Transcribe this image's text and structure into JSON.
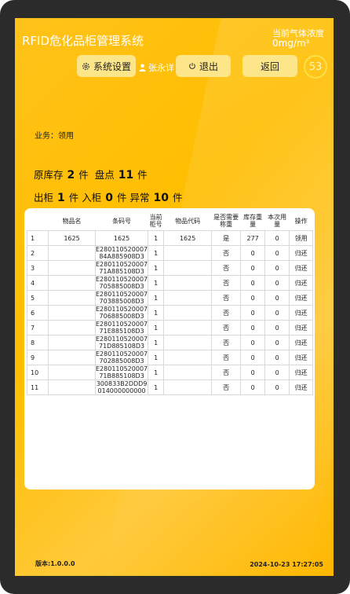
{
  "app": {
    "title": "RFID危化品柜管理系统"
  },
  "gas": {
    "label": "当前气体浓度",
    "value": "0mg/m³"
  },
  "toolbar": {
    "settings_label": "系统设置",
    "user_name": "张永详",
    "logout_label": "退出",
    "back_label": "返回",
    "countdown": "53"
  },
  "business": {
    "text": "业务：领用"
  },
  "stats": {
    "original_label": "原库存",
    "original_value": "2",
    "unit": "件",
    "check_label": "盘点",
    "check_value": "11",
    "out_label": "出柜",
    "out_value": "1",
    "in_label": "入柜",
    "in_value": "0",
    "abnormal_label": "异常",
    "abnormal_value": "10"
  },
  "table": {
    "headers": [
      "",
      "物品名",
      "条码号",
      "当前柜号",
      "物品代码",
      "是否需要称重",
      "库存重量",
      "本次用量",
      "操作"
    ],
    "rows": [
      [
        "1",
        "1625",
        "1625",
        "1",
        "1625",
        "是",
        "277",
        "0",
        "领用"
      ],
      [
        "2",
        "",
        "E280110520007 84A885908D3",
        "1",
        "",
        "否",
        "0",
        "0",
        "归还"
      ],
      [
        "3",
        "",
        "E280110520007 71A885108D3",
        "1",
        "",
        "否",
        "0",
        "0",
        "归还"
      ],
      [
        "4",
        "",
        "E280110520007 705885008D3",
        "1",
        "",
        "否",
        "0",
        "0",
        "归还"
      ],
      [
        "5",
        "",
        "E280110520007 703885008D3",
        "1",
        "",
        "否",
        "0",
        "0",
        "归还"
      ],
      [
        "6",
        "",
        "E280110520007 706885008D3",
        "1",
        "",
        "否",
        "0",
        "0",
        "归还"
      ],
      [
        "7",
        "",
        "E280110520007 71E885108D3",
        "1",
        "",
        "否",
        "0",
        "0",
        "归还"
      ],
      [
        "8",
        "",
        "E280110520007 71D885108D3",
        "1",
        "",
        "否",
        "0",
        "0",
        "归还"
      ],
      [
        "9",
        "",
        "E280110520007 702885008D3",
        "1",
        "",
        "否",
        "0",
        "0",
        "归还"
      ],
      [
        "10",
        "",
        "E280110520007 71B885108D3",
        "1",
        "",
        "否",
        "0",
        "0",
        "归还"
      ],
      [
        "11",
        "",
        "300833B2DDD9 014000000000",
        "1",
        "",
        "否",
        "0",
        "0",
        "归还"
      ]
    ]
  },
  "footer": {
    "version": "版本:1.0.0.0",
    "datetime": "2024-10-23 17:27:05"
  }
}
